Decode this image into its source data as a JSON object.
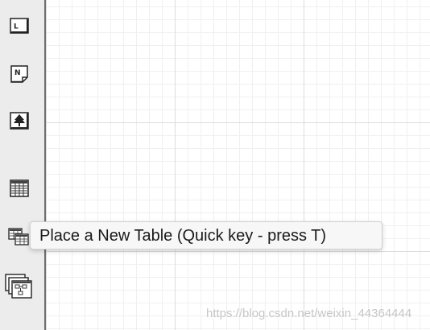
{
  "toolbar": {
    "tools": [
      {
        "icon": "label-tool-icon",
        "glyph": "L"
      },
      {
        "icon": "note-tool-icon",
        "glyph": "N"
      },
      {
        "icon": "tree-tool-icon"
      },
      {
        "icon": "table-tool-icon"
      },
      {
        "icon": "new-table-tool-icon"
      },
      {
        "icon": "view-tool-icon"
      }
    ]
  },
  "tooltip": {
    "text": "Place a New Table (Quick key - press T)"
  },
  "watermark": {
    "text": "https://blog.csdn.net/weixin_44364444"
  }
}
